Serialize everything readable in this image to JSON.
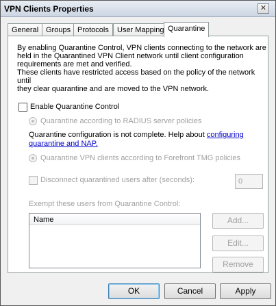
{
  "window": {
    "title": "VPN Clients Properties",
    "close_glyph": "✕"
  },
  "tabs": [
    {
      "label": "General"
    },
    {
      "label": "Groups"
    },
    {
      "label": "Protocols"
    },
    {
      "label": "User Mapping"
    },
    {
      "label": "Quarantine",
      "active": true
    }
  ],
  "quarantine": {
    "desc_line1": "By enabling Quarantine Control, VPN clients connecting to the network are",
    "desc_line2": "held in the Quarantined VPN Client network until client configuration",
    "desc_line3": "requirements are met and verified.",
    "desc_line4": "These clients have restricted access based on the policy of the network until",
    "desc_line5": "they clear quarantine and are moved to the VPN network.",
    "enable_label": "Enable Quarantine Control",
    "enable_checked": false,
    "radius_label": "Quarantine according to RADIUS server policies",
    "incomplete_text": "Quarantine configuration is not complete. Help about ",
    "link_text_1": "configuring",
    "link_text_2": "quarantine and NAP.",
    "tmg_label": "Quarantine VPN clients according to Forefront TMG policies",
    "disconnect_label": "Disconnect quarantined users after (seconds):",
    "disconnect_value": "0",
    "exempt_label": "Exempt these users from Quarantine Control:",
    "list_column": "Name",
    "add_button": "Add...",
    "edit_button": "Edit...",
    "remove_button": "Remove"
  },
  "footer": {
    "ok": "OK",
    "cancel": "Cancel",
    "apply": "Apply"
  }
}
